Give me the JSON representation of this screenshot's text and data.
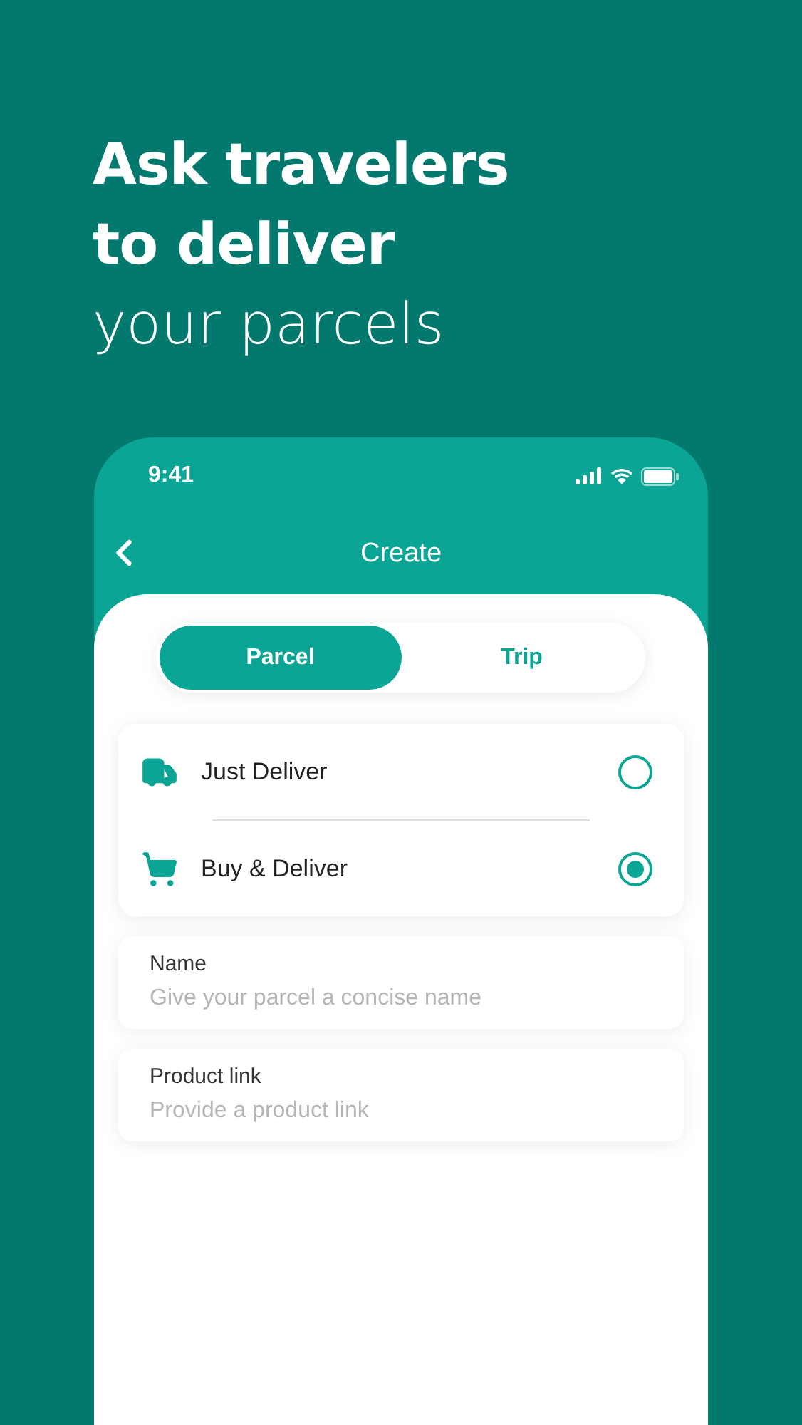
{
  "headline": [
    {
      "text": "Ask travelers",
      "kind": "bold"
    },
    {
      "text": "to deliver",
      "kind": "bold"
    },
    {
      "text": "your parcels",
      "kind": "light"
    }
  ],
  "status_bar": {
    "time": "9:41"
  },
  "header": {
    "title": "Create"
  },
  "tabs": [
    {
      "label": "Parcel",
      "selected": true
    },
    {
      "label": "Trip",
      "selected": false
    }
  ],
  "options": [
    {
      "label": "Just Deliver",
      "kind": "truck",
      "selected": false
    },
    {
      "label": "Buy & Deliver",
      "kind": "cart",
      "selected": true
    }
  ],
  "fields": [
    {
      "label": "Name",
      "placeholder": "Give your parcel a concise name"
    },
    {
      "label": "Product link",
      "placeholder": "Provide a product link"
    }
  ]
}
